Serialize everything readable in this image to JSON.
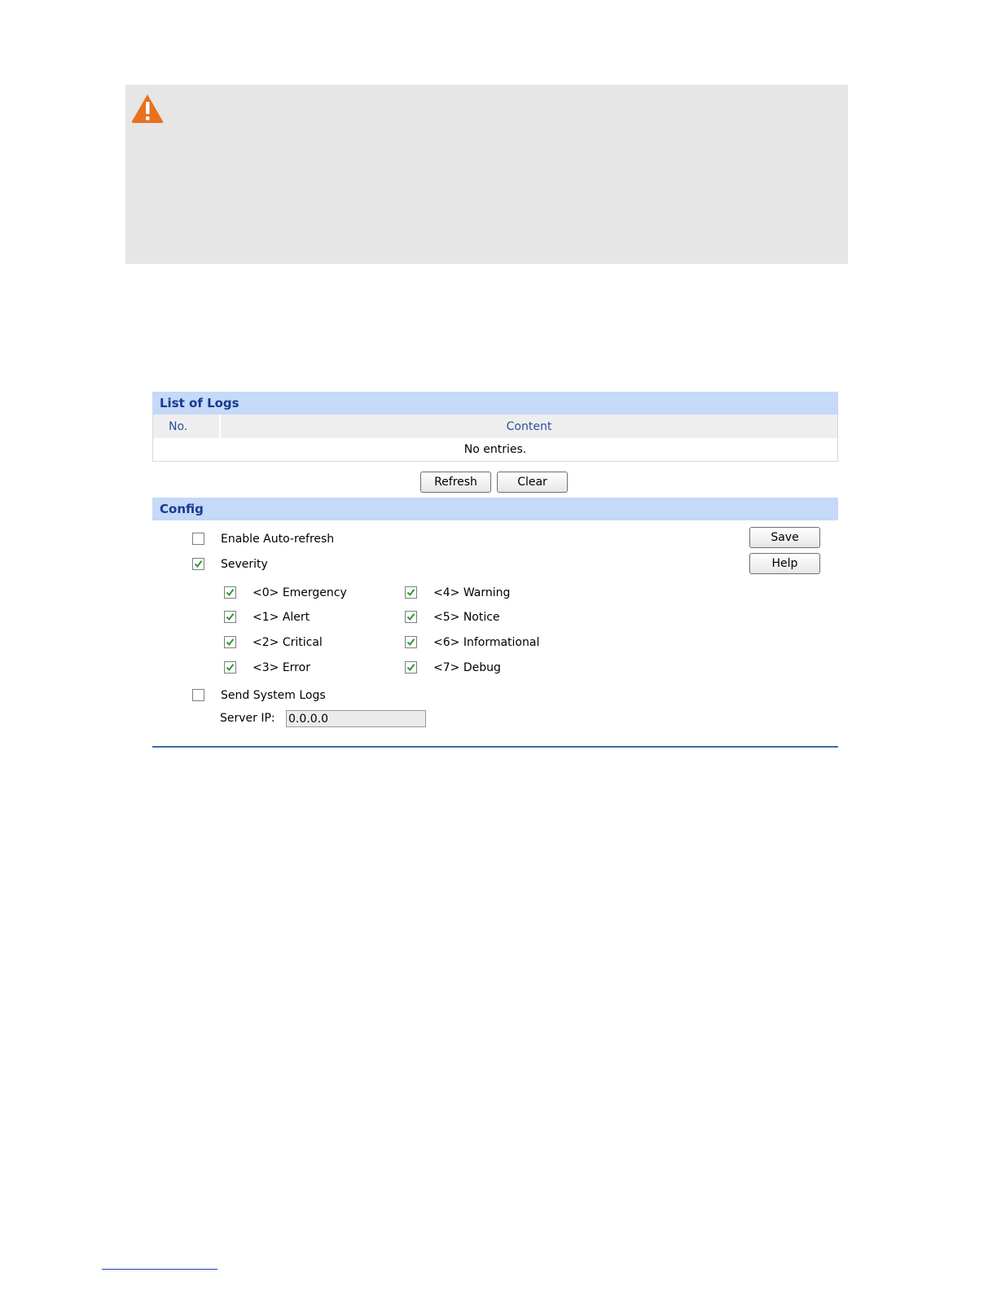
{
  "list_of_logs": {
    "title": "List of Logs",
    "columns": [
      "No.",
      "Content"
    ],
    "empty_message": "No entries."
  },
  "log_actions": {
    "refresh_label": "Refresh",
    "clear_label": "Clear"
  },
  "config": {
    "title": "Config",
    "save_label": "Save",
    "help_label": "Help",
    "auto_refresh": {
      "label": "Enable Auto-refresh",
      "checked": false
    },
    "severity": {
      "label": "Severity",
      "checked": true
    },
    "levels": [
      {
        "label": "<0> Emergency",
        "checked": true
      },
      {
        "label": "<1> Alert",
        "checked": true
      },
      {
        "label": "<2> Critical",
        "checked": true
      },
      {
        "label": "<3> Error",
        "checked": true
      },
      {
        "label": "<4> Warning",
        "checked": true
      },
      {
        "label": "<5> Notice",
        "checked": true
      },
      {
        "label": "<6> Informational",
        "checked": true
      },
      {
        "label": "<7> Debug",
        "checked": true
      }
    ],
    "send_logs": {
      "label": "Send System Logs",
      "checked": false
    },
    "server_ip": {
      "label": "Server IP:",
      "value": "0.0.0.0"
    }
  },
  "colors": {
    "warning_icon": "#e8711e",
    "check_mark": "#2a9a2a",
    "header_bg": "#c5d9f8",
    "header_text": "#1a3a8f"
  },
  "icons": {
    "warning": "warning-triangle-icon",
    "check": "check-icon"
  }
}
